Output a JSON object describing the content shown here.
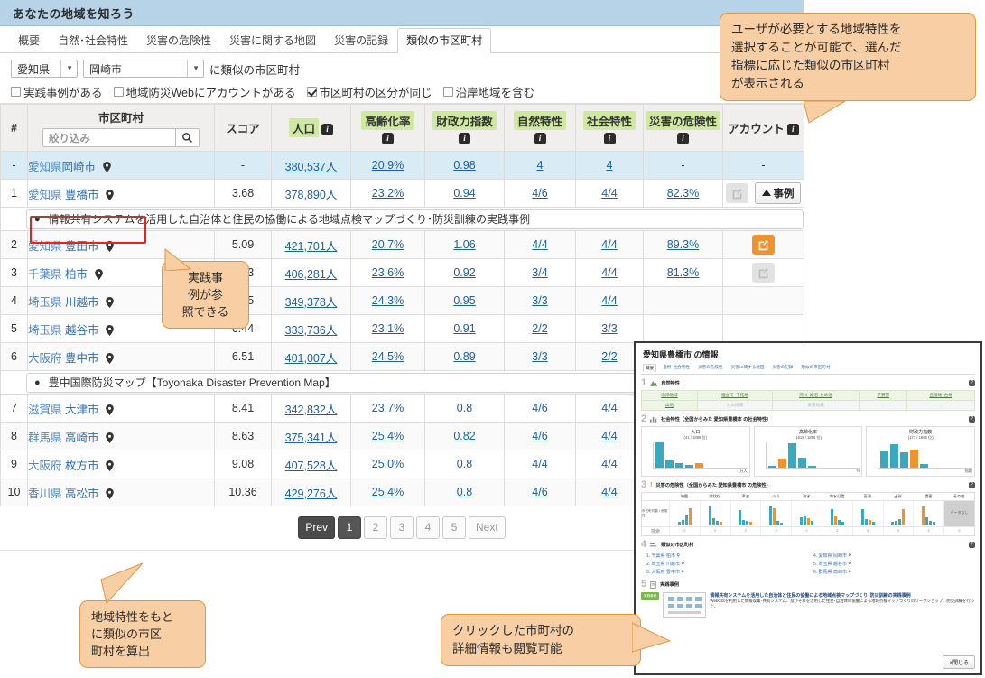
{
  "app": {
    "title": "あなたの地域を知ろう",
    "tabs": [
      {
        "label": "概要",
        "active": false
      },
      {
        "label": "自然･社会特性",
        "active": false
      },
      {
        "label": "災害の危険性",
        "active": false
      },
      {
        "label": "災害に関する地図",
        "active": false
      },
      {
        "label": "災害の記録",
        "active": false
      },
      {
        "label": "類似の市区町村",
        "active": true
      }
    ]
  },
  "filter": {
    "prefecture": "愛知県",
    "city": "岡崎市",
    "suffix_label": "に類似の市区町村",
    "checkboxes": [
      {
        "label": "実践事例がある",
        "checked": false
      },
      {
        "label": "地域防災Webにアカウントがある",
        "checked": false
      },
      {
        "label": "市区町村の区分が同じ",
        "checked": true
      },
      {
        "label": "沿岸地域を含む",
        "checked": false
      }
    ]
  },
  "table": {
    "headers": {
      "num": "#",
      "city": "市区町村",
      "city_search_placeholder": "絞り込み",
      "score": "スコア",
      "population": "人口",
      "aging": "高齢化率",
      "fiscal": "財政力指数",
      "nature": "自然特性",
      "society": "社会特性",
      "risk": "災害の危険性",
      "account": "アカウント"
    },
    "rows": [
      {
        "num": "-",
        "pref": "愛知県",
        "city": "岡崎市",
        "score": "-",
        "pop": "380,537人",
        "aging": "20.9%",
        "fiscal": "0.98",
        "nature": "4",
        "society": "4",
        "risk": "-",
        "account": "-",
        "kind": "base"
      },
      {
        "num": "1",
        "pref": "愛知県",
        "city": "豊橋市",
        "score": "3.68",
        "pop": "378,890人",
        "aging": "23.2%",
        "fiscal": "0.94",
        "nature": "4/6",
        "society": "4/4",
        "risk": "82.3%",
        "account": "off",
        "case_button": "事例",
        "highlight": true
      },
      {
        "num": "2",
        "pref": "愛知県",
        "city": "豊田市",
        "score": "5.09",
        "pop": "421,701人",
        "aging": "20.7%",
        "fiscal": "1.06",
        "nature": "4/4",
        "society": "4/4",
        "risk": "89.3%",
        "account": "on"
      },
      {
        "num": "3",
        "pref": "千葉県",
        "city": "柏市",
        "score": "5.23",
        "pop": "406,281人",
        "aging": "23.6%",
        "fiscal": "0.92",
        "nature": "3/4",
        "society": "4/4",
        "risk": "81.3%",
        "account": "off"
      },
      {
        "num": "4",
        "pref": "埼玉県",
        "city": "川越市",
        "score": "6.05",
        "pop": "349,378人",
        "aging": "24.3%",
        "fiscal": "0.95",
        "nature": "3/3",
        "society": "4/4",
        "risk": "",
        "account": ""
      },
      {
        "num": "5",
        "pref": "埼玉県",
        "city": "越谷市",
        "score": "6.44",
        "pop": "333,736人",
        "aging": "23.1%",
        "fiscal": "0.91",
        "nature": "2/2",
        "society": "3/3",
        "risk": "",
        "account": ""
      },
      {
        "num": "6",
        "pref": "大阪府",
        "city": "豊中市",
        "score": "6.51",
        "pop": "401,007人",
        "aging": "24.5%",
        "fiscal": "0.89",
        "nature": "3/3",
        "society": "2/2",
        "risk": "",
        "account": ""
      },
      {
        "num": "7",
        "pref": "滋賀県",
        "city": "大津市",
        "score": "8.41",
        "pop": "342,832人",
        "aging": "23.7%",
        "fiscal": "0.8",
        "nature": "4/6",
        "society": "4/4",
        "risk": "",
        "account": ""
      },
      {
        "num": "8",
        "pref": "群馬県",
        "city": "高崎市",
        "score": "8.63",
        "pop": "375,341人",
        "aging": "25.4%",
        "fiscal": "0.82",
        "nature": "4/6",
        "society": "4/4",
        "risk": "",
        "account": ""
      },
      {
        "num": "9",
        "pref": "大阪府",
        "city": "枚方市",
        "score": "9.08",
        "pop": "407,528人",
        "aging": "25.0%",
        "fiscal": "0.8",
        "nature": "4/4",
        "society": "4/4",
        "risk": "",
        "account": ""
      },
      {
        "num": "10",
        "pref": "香川県",
        "city": "高松市",
        "score": "10.36",
        "pop": "429,276人",
        "aging": "25.4%",
        "fiscal": "0.8",
        "nature": "4/6",
        "society": "4/4",
        "risk": "",
        "account": ""
      }
    ],
    "expansions": {
      "row1": "情報共有システムを活用した自治体と住民の協働による地域点検マップづくり･防災訓練の実践事例",
      "row6": "豊中国際防災マップ【Toyonaka Disaster Prevention Map】"
    }
  },
  "pagination": {
    "prev": "Prev",
    "pages": [
      "1",
      "2",
      "3",
      "4",
      "5"
    ],
    "current": "1",
    "next": "Next"
  },
  "callouts": {
    "top_right": "ユーザが必要とする地域特性を\n選択することが可能で、選んだ\n指標に応じた類似の市区町村\nが表示される",
    "case_ref": "実践事\n例が参\n照できる",
    "compute": "地域特性をもと\nに類似の市区\n町村を算出",
    "detail": "クリックした市町村の\n詳細情報も閲覧可能"
  },
  "inset": {
    "title": "愛知県豊橋市 の情報",
    "tabs": [
      "概要",
      "自然･社会特性",
      "災害の危険性",
      "災害に関する地図",
      "災害の記録",
      "類似の市区町村"
    ],
    "sections": [
      {
        "num": "1",
        "title": "自然特性"
      },
      {
        "num": "2",
        "title": "社会特性（全国からみた 愛知県豊橋市 の社会特性）"
      },
      {
        "num": "3",
        "title": "災害の危険性（全国からみた 愛知県豊橋市 の危険性）"
      },
      {
        "num": "4",
        "title": "類似の市区町村"
      },
      {
        "num": "5",
        "title": "実践事例"
      }
    ],
    "nature_terms_row1": [
      "沿岸地域",
      "埋立て･干拓地",
      "河川･湖沼･ため池",
      "平野部",
      "丘陵地･台地"
    ],
    "nature_terms_row2": [
      "山地",
      "火山地域",
      "多雪地域",
      "-",
      "-"
    ],
    "social_charts": [
      {
        "title": "人口",
        "subtitle": "(41 / 1896 位)",
        "values": [
          100,
          33,
          18,
          10,
          17
        ],
        "highlight_index": 4,
        "ylabel": "市区町村数",
        "xlabel": "万人"
      },
      {
        "title": "高齢化率",
        "subtitle": "(1619 / 1896 位)",
        "values": [
          4,
          30,
          85,
          32,
          5
        ],
        "highlight_index": 1,
        "ylabel": "市区町村数",
        "xlabel": "%"
      },
      {
        "title": "財政力指数",
        "subtitle": "(177 / 1896 位)",
        "values": [
          55,
          80,
          52,
          62,
          12
        ],
        "highlight_index": 3,
        "ylabel": "市区町村数",
        "xlabel": "指数"
      }
    ],
    "risk_headers": [
      "地震",
      "液状化",
      "津波",
      "火山",
      "洪水",
      "内水氾濫",
      "高潮",
      "土砂",
      "雪害",
      "その他"
    ],
    "risk_no_data": "データなし",
    "risk_search_label": "検索",
    "risk_axis": "市区町村数 / 危険性",
    "similar_list": [
      "1. 千葉県 柏市",
      "4. 愛知県 岡崎市",
      "2. 埼玉県 川越市",
      "5. 埼玉県 越谷市",
      "3. 大阪府 豊中市",
      "6. 群馬県 高崎市"
    ],
    "case": {
      "tag": "実践事例",
      "heading": "情報共有システムを活用した自治体と住民の協働による地域点検マップづくり･防災訓練の実践事例",
      "body": "WebGISを利用した情報収集･共有システム、及びそれを活用した住民･自治体の協働による地域点検マップづくりのワークショップ、防災訓練を行った。"
    },
    "close_label": "×閉じる"
  },
  "colors": {
    "title_bar": "#b7d3e8",
    "highlight_green": "#cfeaa0",
    "callout_bg": "#f8cfa4",
    "callout_border": "#e3953c",
    "accent_orange": "#f0932e",
    "base_row": "#d9ecf6",
    "link_blue": "#1a5fa8",
    "red_box": "#e8231a"
  }
}
